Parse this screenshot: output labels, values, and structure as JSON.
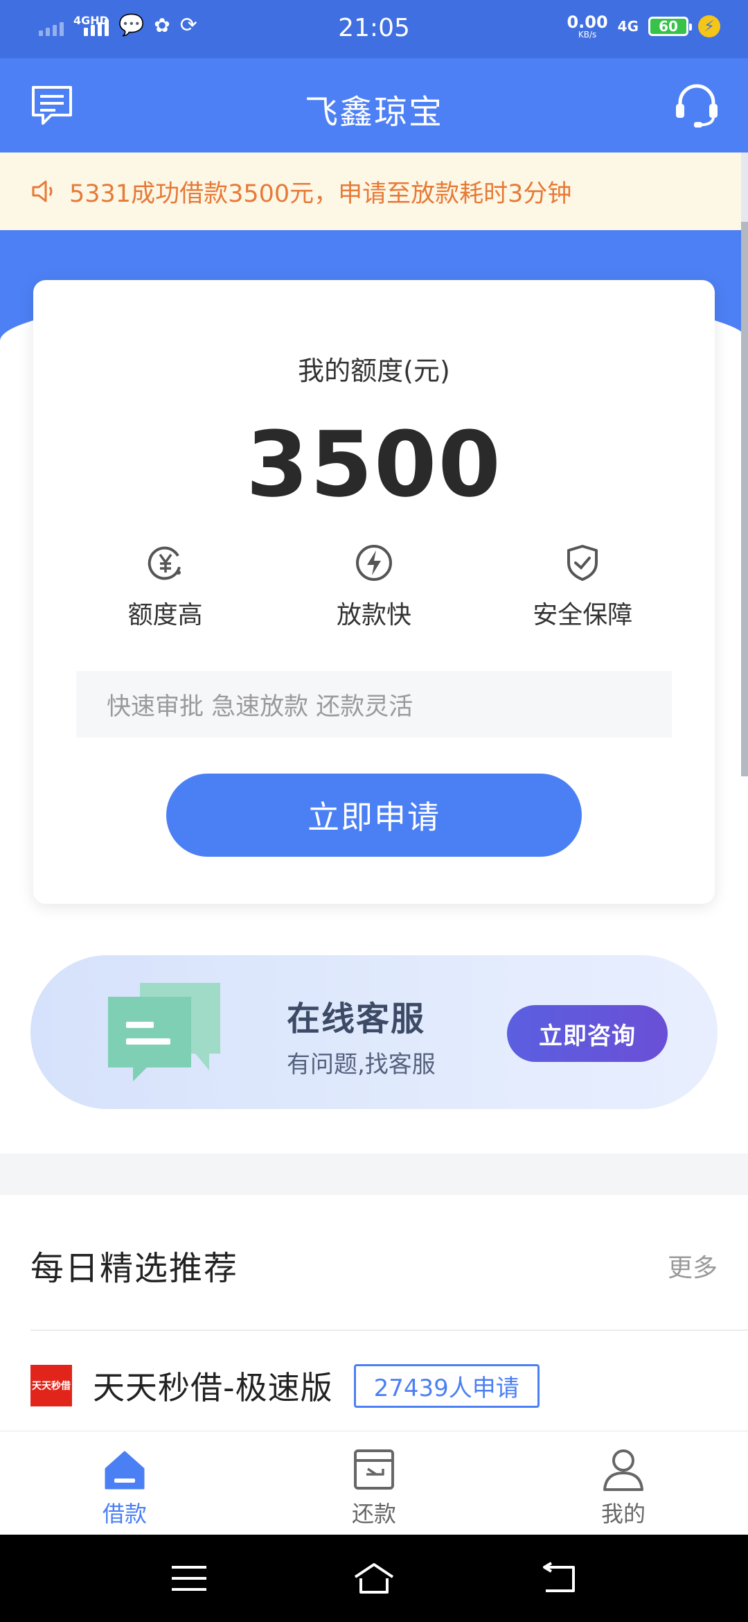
{
  "status_bar": {
    "network_1": "4GHD",
    "time": "21:05",
    "speed_value": "0.00",
    "speed_unit": "KB/s",
    "network_2": "4G",
    "battery": "60"
  },
  "header": {
    "title": "飞鑫琼宝"
  },
  "notice": {
    "text": "5331成功借款3500元，申请至放款耗时3分钟"
  },
  "quota_card": {
    "label": "我的额度(元)",
    "value": "3500",
    "features": [
      {
        "icon": "yuan-icon",
        "label": "额度高"
      },
      {
        "icon": "lightning-icon",
        "label": "放款快"
      },
      {
        "icon": "shield-check-icon",
        "label": "安全保障"
      }
    ],
    "slogan": "快速审批 急速放款 还款灵活",
    "apply_label": "立即申请"
  },
  "service_banner": {
    "title": "在线客服",
    "subtitle": "有问题,找客服",
    "button_label": "立即咨询"
  },
  "recommendations": {
    "title": "每日精选推荐",
    "more_label": "更多",
    "items": [
      {
        "logo_text": "天天秒借",
        "name": "天天秒借-极速版",
        "badge": "27439人申请"
      }
    ]
  },
  "tabbar": {
    "items": [
      {
        "label": "借款",
        "icon": "home-icon",
        "active": true
      },
      {
        "label": "还款",
        "icon": "repay-icon",
        "active": false
      },
      {
        "label": "我的",
        "icon": "user-icon",
        "active": false
      }
    ]
  },
  "colors": {
    "brand_blue": "#4d80f4",
    "notice_text": "#e67a37",
    "consult_purple": "#5b5fe0"
  }
}
